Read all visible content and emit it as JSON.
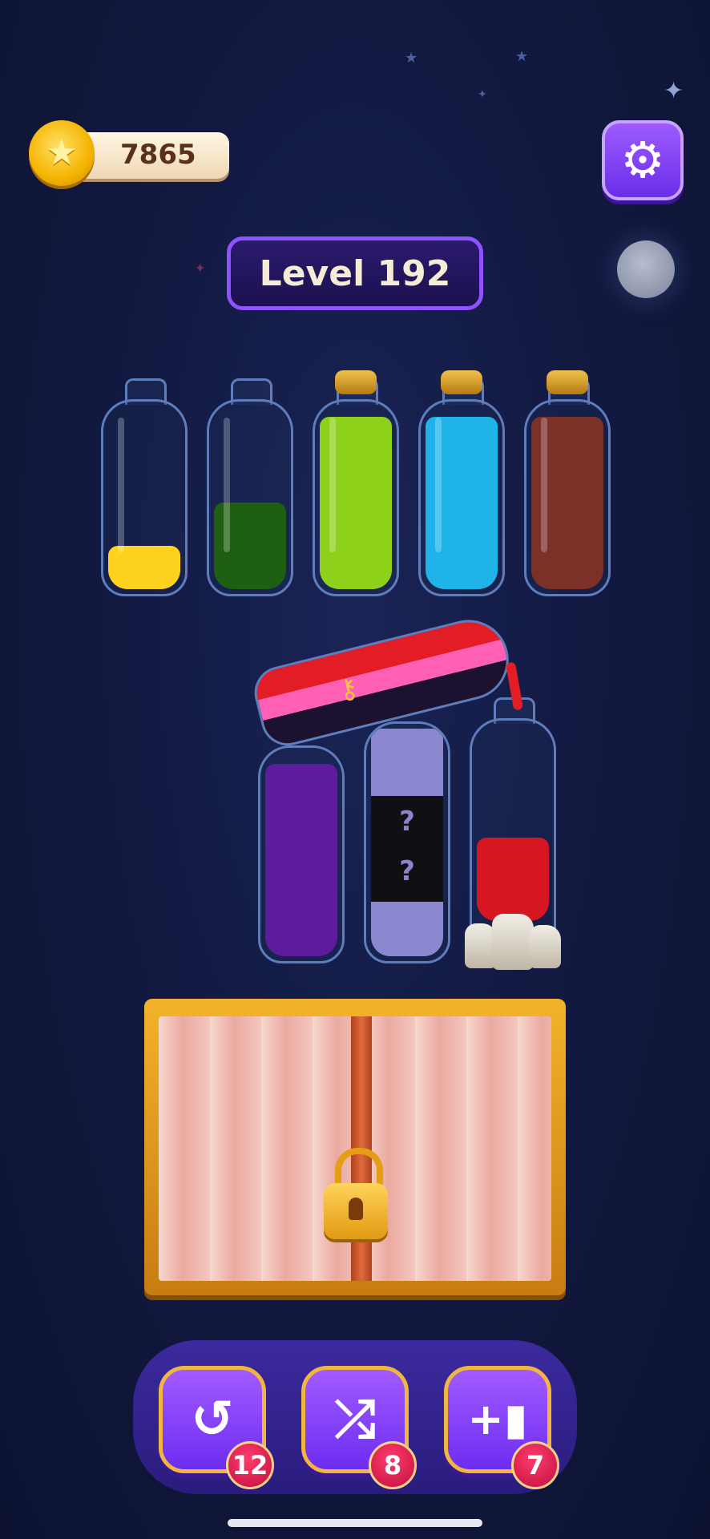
{
  "coins": {
    "value": "7865",
    "icon": "star-coin-icon"
  },
  "level": {
    "label": "Level 192"
  },
  "settings": {
    "icon": "gear-icon",
    "glyph": "⚙"
  },
  "top_bottles": [
    {
      "color": "#ffd21f",
      "fill_fraction": 0.25,
      "corked": false
    },
    {
      "color": "#1f5f12",
      "fill_fraction": 0.5,
      "corked": false
    },
    {
      "color": "#8ed11b",
      "fill_fraction": 1.0,
      "corked": true
    },
    {
      "color": "#1fb3e8",
      "fill_fraction": 1.0,
      "corked": true
    },
    {
      "color": "#7b3028",
      "fill_fraction": 1.0,
      "corked": true
    }
  ],
  "pouring_bottle": {
    "colors": [
      "#e31d25",
      "#ff5fb4"
    ],
    "icon": "key-icon"
  },
  "bottom_bottles": [
    {
      "color": "#5c1c9c",
      "fill_fraction": 1.0
    },
    {
      "color": "#8a87cf",
      "hidden_layers": [
        "?",
        "?"
      ]
    },
    {
      "color": "#d61620",
      "fill_fraction": 0.4
    }
  ],
  "locked_slot": {
    "icon": "padlock-icon"
  },
  "tools": [
    {
      "name": "undo",
      "icon": "undo-icon",
      "glyph": "↺",
      "count": "12"
    },
    {
      "name": "shuffle",
      "icon": "shuffle-icon",
      "glyph": "⤮",
      "count": "8"
    },
    {
      "name": "add-bottle",
      "icon": "add-bottle-icon",
      "glyph": "+▮",
      "count": "7"
    }
  ]
}
